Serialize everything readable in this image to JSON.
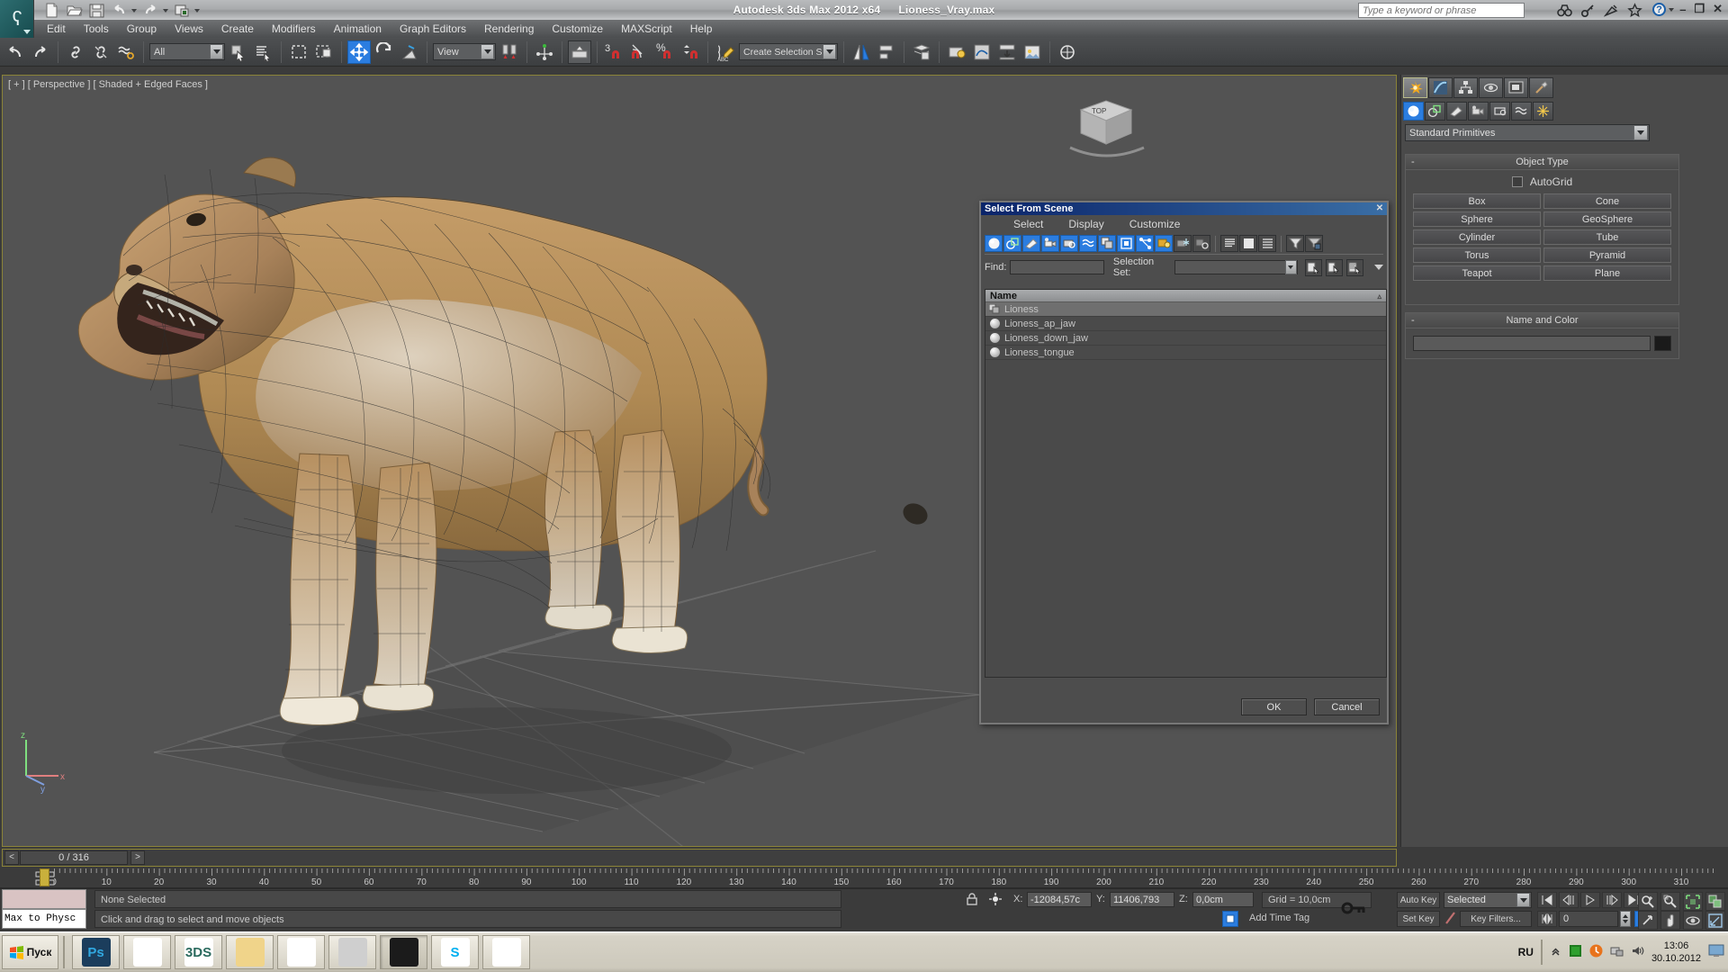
{
  "window": {
    "app_title": "Autodesk 3ds Max  2012 x64",
    "file_title": "Lioness_Vray.max",
    "search_placeholder": "Type a keyword or phrase",
    "minimize": "–",
    "restore": "❐",
    "close": "✕",
    "help_glyph": "?"
  },
  "quick_access": [
    {
      "name": "new-file-icon",
      "glyph": "Ὄ4"
    },
    {
      "name": "open-file-icon",
      "glyph": "Ὄ2"
    },
    {
      "name": "save-file-icon",
      "glyph": "ὋE"
    },
    {
      "name": "undo-icon",
      "glyph": "↶"
    },
    {
      "name": "redo-icon",
      "glyph": "↷"
    },
    {
      "name": "project-folder-icon",
      "glyph": "὜2"
    }
  ],
  "menu": {
    "items": [
      {
        "label": "Edit"
      },
      {
        "label": "Tools"
      },
      {
        "label": "Group"
      },
      {
        "label": "Views"
      },
      {
        "label": "Create"
      },
      {
        "label": "Modifiers"
      },
      {
        "label": "Animation"
      },
      {
        "label": "Graph Editors"
      },
      {
        "label": "Rendering"
      },
      {
        "label": "Customize"
      },
      {
        "label": "MAXScript"
      },
      {
        "label": "Help"
      }
    ]
  },
  "toolbar": {
    "selection_filter": "All",
    "reference_coord": "View",
    "named_selection_set": "Create Selection Set",
    "snap_angle_value": "3",
    "snap_percent": "%"
  },
  "viewport": {
    "label": "[ + ] [ Perspective ] [ Shaded + Edged Faces ]",
    "viewcube_label": "TOP",
    "axis_x": "x",
    "axis_y": "z",
    "axis_z": "y"
  },
  "command_panel": {
    "tabs": [
      {
        "name": "create-tab",
        "icon": "star-icon",
        "selected": true
      },
      {
        "name": "modify-tab",
        "icon": "curve-icon",
        "selected": false
      },
      {
        "name": "hierarchy-tab",
        "icon": "hierarchy-icon",
        "selected": false
      },
      {
        "name": "motion-tab",
        "icon": "motion-icon",
        "selected": false
      },
      {
        "name": "display-tab",
        "icon": "display-icon",
        "selected": false
      },
      {
        "name": "utilities-tab",
        "icon": "hammer-icon",
        "selected": false
      }
    ],
    "categories": [
      {
        "name": "geometry-category",
        "selected": true
      },
      {
        "name": "shapes-category",
        "selected": false
      },
      {
        "name": "lights-category",
        "selected": false
      },
      {
        "name": "cameras-category",
        "selected": false
      },
      {
        "name": "helpers-category",
        "selected": false
      },
      {
        "name": "space-warps-category",
        "selected": false
      },
      {
        "name": "systems-category",
        "selected": false
      }
    ],
    "dropdown": "Standard Primitives",
    "object_type": {
      "title": "Object Type",
      "minus": "-",
      "autogrid_label": "AutoGrid",
      "buttons": [
        "Box",
        "Cone",
        "Sphere",
        "GeoSphere",
        "Cylinder",
        "Tube",
        "Torus",
        "Pyramid",
        "Teapot",
        "Plane"
      ]
    },
    "name_and_color": {
      "title": "Name and Color",
      "minus": "-",
      "name_value": ""
    }
  },
  "dialog": {
    "title": "Select From Scene",
    "close_glyph": "✕",
    "menu": [
      "Select",
      "Display",
      "Customize"
    ],
    "find_label": "Find:",
    "find_value": "",
    "selection_set_label": "Selection Set:",
    "selection_set_value": "",
    "list_header": "Name",
    "sort_glyph": "▵",
    "items": [
      {
        "label": "Lioness",
        "icon": "group-icon",
        "selected": true
      },
      {
        "label": "Lioness_ap_jaw",
        "icon": "geometry-icon",
        "selected": false
      },
      {
        "label": "Lioness_down_jaw",
        "icon": "geometry-icon",
        "selected": false
      },
      {
        "label": "Lioness_tongue",
        "icon": "geometry-icon",
        "selected": false
      }
    ],
    "ok_label": "OK",
    "cancel_label": "Cancel"
  },
  "time_slider": {
    "prev_glyph": "<",
    "frame_text": "0 / 316",
    "next_glyph": ">"
  },
  "track_bar": {
    "ticks": [
      0,
      10,
      20,
      30,
      40,
      50,
      60,
      70,
      80,
      90,
      100,
      110,
      120,
      130,
      140,
      150,
      160,
      170,
      180,
      190,
      200,
      210,
      220,
      230,
      240,
      250,
      260,
      270,
      280,
      290,
      300,
      310
    ]
  },
  "status": {
    "max_to_physc": "Max to Physc",
    "selection": "None Selected",
    "prompt": "Click and drag to select and move objects",
    "x_label": "X:",
    "x_value": "-12084,57c",
    "y_label": "Y:",
    "y_value": "11406,793",
    "z_label": "Z:",
    "z_value": "0,0cm",
    "grid": "Grid = 10,0cm",
    "add_time_tag": "Add Time Tag"
  },
  "animation": {
    "auto_key": "Auto Key",
    "set_key": "Set Key",
    "key_mode": "Selected",
    "key_filters": "Key Filters...",
    "current_frame": "0"
  },
  "taskbar": {
    "start_label": "Пуск",
    "items": [
      {
        "name": "taskbar-photoshop",
        "label": "Ps",
        "color": "#1b3d5c",
        "fg": "#31a8e0"
      },
      {
        "name": "taskbar-feather-app",
        "label": "",
        "color": "#ffffff",
        "fg": "#3a6fb0"
      },
      {
        "name": "taskbar-3ds-max-doc",
        "label": "3DS",
        "color": "#ffffff",
        "fg": "#2a6a5e"
      },
      {
        "name": "taskbar-folder",
        "label": "",
        "color": "#f0d48a",
        "fg": "#c69a2c"
      },
      {
        "name": "taskbar-notes",
        "label": "",
        "color": "#ffffff",
        "fg": "#333333"
      },
      {
        "name": "taskbar-monitor",
        "label": "",
        "color": "#cfcfcf",
        "fg": "#2c5a2c"
      },
      {
        "name": "taskbar-3ds-max",
        "label": "",
        "color": "#1b1b1b",
        "fg": "#e8f5f5"
      },
      {
        "name": "taskbar-skype",
        "label": "S",
        "color": "#ffffff",
        "fg": "#00aff0"
      },
      {
        "name": "taskbar-chrome",
        "label": "",
        "color": "#ffffff",
        "fg": "#4285f4"
      }
    ],
    "language": "RU",
    "time": "13:06",
    "date": "30.10.2012"
  },
  "colors": {
    "accent_blue": "#2b7de0",
    "title_blue": "#0a246a",
    "viewport_bg": "#535353",
    "panel_bg": "#4a4a4a",
    "border_gold": "#8a8338"
  }
}
